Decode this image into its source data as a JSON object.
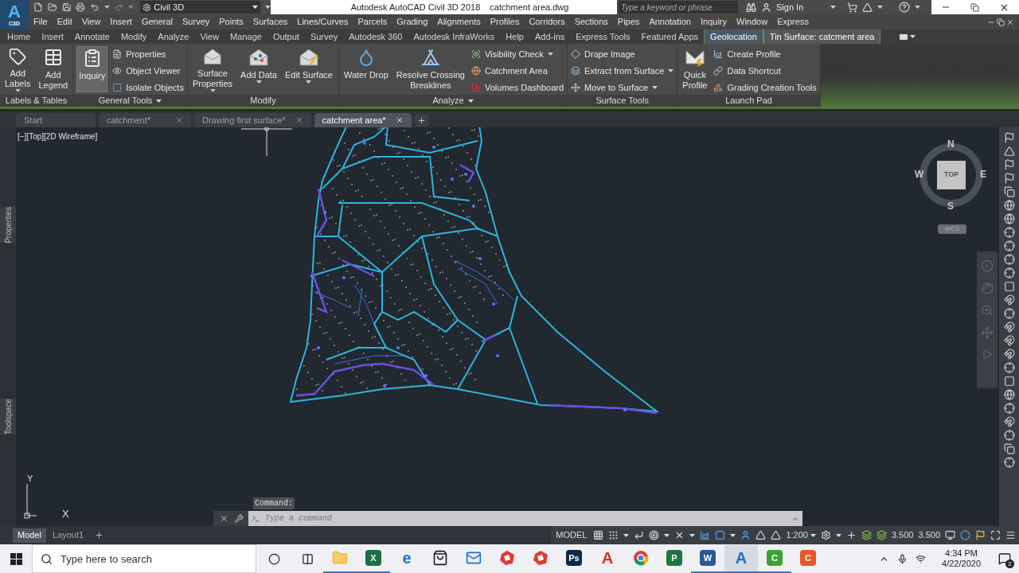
{
  "app_button": {
    "letter": "A",
    "label": "C3D"
  },
  "workspace": "Civil 3D",
  "title": {
    "app": "Autodesk AutoCAD Civil 3D 2018",
    "file": "catchment area.dwg"
  },
  "search": {
    "placeholder": "Type a keyword or phrase"
  },
  "sign_in": "Sign In",
  "menu_bar": [
    "File",
    "Edit",
    "View",
    "Insert",
    "General",
    "Survey",
    "Points",
    "Surfaces",
    "Lines/Curves",
    "Parcels",
    "Grading",
    "Alignments",
    "Profiles",
    "Corridors",
    "Sections",
    "Pipes",
    "Annotation",
    "Inquiry",
    "Window",
    "Express"
  ],
  "ribbon_tabs": [
    {
      "label": "Home",
      "selected": false,
      "contextual": false
    },
    {
      "label": "Insert",
      "selected": false,
      "contextual": false
    },
    {
      "label": "Annotate",
      "selected": false,
      "contextual": false
    },
    {
      "label": "Modify",
      "selected": false,
      "contextual": false
    },
    {
      "label": "Analyze",
      "selected": false,
      "contextual": false
    },
    {
      "label": "View",
      "selected": false,
      "contextual": false
    },
    {
      "label": "Manage",
      "selected": false,
      "contextual": false
    },
    {
      "label": "Output",
      "selected": false,
      "contextual": false
    },
    {
      "label": "Survey",
      "selected": false,
      "contextual": false
    },
    {
      "label": "Autodesk 360",
      "selected": false,
      "contextual": false
    },
    {
      "label": "Autodesk InfraWorks",
      "selected": false,
      "contextual": false
    },
    {
      "label": "Help",
      "selected": false,
      "contextual": false
    },
    {
      "label": "Add-ins",
      "selected": false,
      "contextual": false
    },
    {
      "label": "Express Tools",
      "selected": false,
      "contextual": false
    },
    {
      "label": "Featured Apps",
      "selected": false,
      "contextual": false
    },
    {
      "label": "Geolocation",
      "selected": false,
      "contextual": true
    },
    {
      "label": "Tin Surface: catcment area",
      "selected": true,
      "contextual": true
    }
  ],
  "ribbon_panels": [
    {
      "title": "Labels & Tables",
      "has_menu": false,
      "items": [
        {
          "kind": "large",
          "lines": [
            "Add",
            "Labels"
          ],
          "dropdown": true,
          "active": false
        },
        {
          "kind": "large",
          "lines": [
            "Add",
            "Legend"
          ],
          "dropdown": false,
          "active": false
        }
      ]
    },
    {
      "title": "General Tools",
      "has_menu": true,
      "items": [
        {
          "kind": "large",
          "lines": [
            "Inquiry"
          ],
          "dropdown": false,
          "active": true
        },
        {
          "kind": "stack",
          "entries": [
            {
              "label": "Properties",
              "dropdown": false
            },
            {
              "label": "Object Viewer",
              "dropdown": false
            },
            {
              "label": "Isolate Objects",
              "dropdown": false
            }
          ]
        }
      ]
    },
    {
      "title": "Modify",
      "has_menu": false,
      "items": [
        {
          "kind": "large",
          "lines": [
            "Surface",
            "Properties"
          ],
          "dropdown": true,
          "active": false
        },
        {
          "kind": "large",
          "lines": [
            "Add Data"
          ],
          "dropdown": true,
          "active": false
        },
        {
          "kind": "large",
          "lines": [
            "Edit Surface"
          ],
          "dropdown": true,
          "active": false
        }
      ]
    },
    {
      "title": "Analyze",
      "has_menu": true,
      "items": [
        {
          "kind": "large",
          "lines": [
            "Water Drop"
          ],
          "dropdown": false,
          "active": false
        },
        {
          "kind": "large",
          "lines": [
            "Resolve Crossing",
            "Breaklines"
          ],
          "dropdown": false,
          "active": false
        },
        {
          "kind": "stack",
          "entries": [
            {
              "label": "Visibility Check",
              "dropdown": true
            },
            {
              "label": "Catchment Area",
              "dropdown": false
            },
            {
              "label": "Volumes Dashboard",
              "dropdown": false
            }
          ]
        }
      ]
    },
    {
      "title": "Surface Tools",
      "has_menu": false,
      "items": [
        {
          "kind": "stack",
          "entries": [
            {
              "label": "Drape Image",
              "dropdown": false
            },
            {
              "label": "Extract from Surface",
              "dropdown": true
            },
            {
              "label": "Move to Surface",
              "dropdown": true
            }
          ]
        }
      ]
    },
    {
      "title": "Launch Pad",
      "has_menu": false,
      "items": [
        {
          "kind": "large",
          "lines": [
            "Quick",
            "Profile"
          ],
          "dropdown": false,
          "active": false
        },
        {
          "kind": "stack",
          "entries": [
            {
              "label": "Create Profile",
              "dropdown": false
            },
            {
              "label": "Data Shortcut",
              "dropdown": false
            },
            {
              "label": "Grading Creation Tools",
              "dropdown": false
            }
          ]
        }
      ]
    }
  ],
  "doc_tabs": [
    {
      "label": "Start",
      "selected": false,
      "closable": false
    },
    {
      "label": "catchment*",
      "selected": false,
      "closable": true
    },
    {
      "label": "Drawing first surface*",
      "selected": false,
      "closable": true
    },
    {
      "label": "catchment area*",
      "selected": true,
      "closable": true
    }
  ],
  "viewport_label": "[−][Top][2D Wireframe]",
  "palettes": [
    "Properties",
    "Toolspace"
  ],
  "viewcube": {
    "north": "N",
    "south": "S",
    "east": "E",
    "west": "W",
    "face": "TOP",
    "ucs": "WCS"
  },
  "ucs_icon": {
    "x": "X",
    "y": "Y"
  },
  "command": {
    "history": "Command:",
    "placeholder": "Type a command"
  },
  "layout_tabs": [
    {
      "label": "Model",
      "selected": true
    },
    {
      "label": "Layout1",
      "selected": false
    }
  ],
  "status_bar": {
    "space": "MODEL",
    "scale": "1:200",
    "value_1": "3.500",
    "value_2": "3.500"
  },
  "taskbar": {
    "search_placeholder": "Type here to search",
    "time": "4:34 PM",
    "date": "4/22/2020",
    "notifications": "2",
    "apps": [
      {
        "kind": "folder",
        "running": true,
        "selected": false
      },
      {
        "kind": "tile",
        "glyph": "X",
        "color": "#1d7044",
        "running": true,
        "selected": false
      },
      {
        "kind": "letter",
        "glyph": "e",
        "color": "#1a73c8",
        "running": false,
        "selected": false
      },
      {
        "kind": "store",
        "running": false,
        "selected": false
      },
      {
        "kind": "mail",
        "running": false,
        "selected": false
      },
      {
        "kind": "sketchup",
        "running": false,
        "selected": false
      },
      {
        "kind": "sketchup",
        "running": false,
        "selected": false
      },
      {
        "kind": "tile",
        "glyph": "Ps",
        "color": "#0b2a4a",
        "running": false,
        "selected": false
      },
      {
        "kind": "letter",
        "glyph": "A",
        "color": "#d32f2f",
        "running": false,
        "selected": false
      },
      {
        "kind": "chrome",
        "running": false,
        "selected": false
      },
      {
        "kind": "tile",
        "glyph": "P",
        "color": "#217346",
        "running": false,
        "selected": false
      },
      {
        "kind": "tile",
        "glyph": "W",
        "color": "#2b579a",
        "running": true,
        "selected": false
      },
      {
        "kind": "letter",
        "glyph": "A",
        "color": "#1f6fb5",
        "running": true,
        "selected": true
      },
      {
        "kind": "tile",
        "glyph": "C",
        "color": "#3aa335",
        "running": true,
        "selected": false
      },
      {
        "kind": "tile",
        "glyph": "C",
        "color": "#e8572a",
        "running": false,
        "selected": false
      }
    ]
  }
}
